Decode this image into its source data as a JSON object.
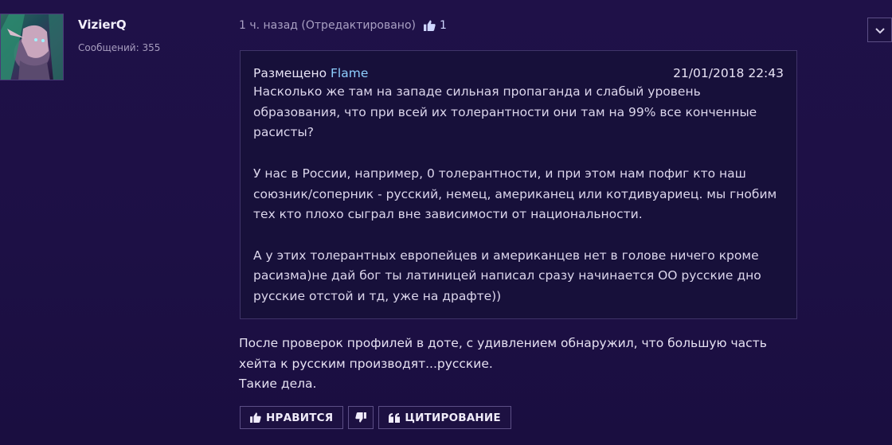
{
  "author": {
    "username": "VizierQ",
    "messages_label": "Сообщений: 355"
  },
  "post_meta": {
    "time": "1 ч. назад (Отредактировано)",
    "like_count": "1"
  },
  "quote": {
    "posted_label": "Размещено",
    "author": "Flame",
    "date": "21/01/2018 22:43",
    "paragraphs": [
      "Насколько же там на западе сильная пропаганда и слабый уровень образования, что при всей их толерантности они там на 99% все конченные расисты?",
      "У нас в России, например, 0 толерантности, и при этом нам пофиг кто наш союзник/соперник - русский, немец, американец или котдивуариец. мы гнобим тех кто плохо сыграл вне зависимости от национальности.",
      "А у этих толерантных европейцев и американцев нет в голове ничего кроме расизма)не дай бог ты латиницей написал сразу начинается ОО русские дно русские отстой и тд, уже на драфте))"
    ]
  },
  "body": {
    "line1": "После проверок профилей в доте, с удивлением обнаружил, что большую часть",
    "line2": "хейта к русским производят...русские.",
    "line3": "Такие дела."
  },
  "actions": {
    "like_label": "НРАВИТСЯ",
    "quote_label": "ЦИТИРОВАНИЕ"
  },
  "icons": {
    "like": "thumbs-up-icon",
    "dislike": "thumbs-down-icon",
    "quote": "quote-icon",
    "menu": "chevron-down-icon"
  },
  "colors": {
    "background": "#1f1148",
    "quote_author": "#8fcfff",
    "like_icon": "#cfd6ff"
  }
}
